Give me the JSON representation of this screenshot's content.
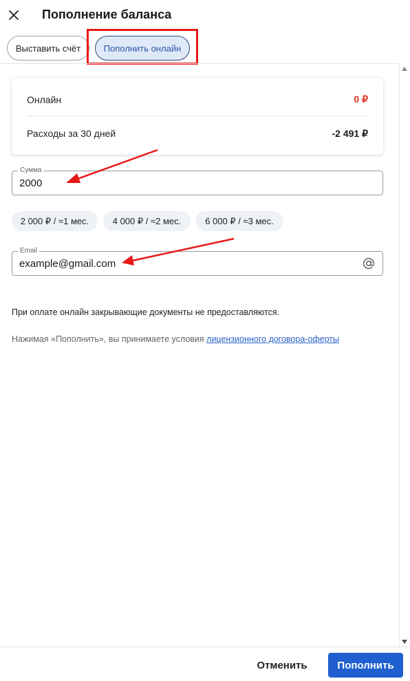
{
  "header": {
    "title": "Пополнение баланса",
    "close_icon": "close-icon"
  },
  "tabs": [
    {
      "label": "Выставить счёт",
      "active": false
    },
    {
      "label": "Пополнить онлайн",
      "active": true
    }
  ],
  "summary": {
    "online_label": "Онлайн",
    "online_value": "0 ₽",
    "expenses_label": "Расходы за 30 дней",
    "expenses_value": "-2 491 ₽"
  },
  "amount_field": {
    "label": "Сумма",
    "value": "2000"
  },
  "presets": [
    "2 000 ₽ / ≈1 мес.",
    "4 000 ₽ / ≈2 мес.",
    "6 000 ₽ / ≈3 мес."
  ],
  "email_field": {
    "label": "Email",
    "value": "example@gmail.com",
    "icon": "at-icon"
  },
  "note": "При оплате онлайн закрывающие документы не предоставляются.",
  "terms": {
    "text": "Нажимая «Пополнить», вы принимаете условия ",
    "link": "лицензионного договора-оферты"
  },
  "footer": {
    "cancel_label": "Отменить",
    "submit_label": "Пополнить"
  },
  "colors": {
    "accent": "#1f5fcf",
    "negative": "#e0301e",
    "annotation": "#e81818"
  }
}
